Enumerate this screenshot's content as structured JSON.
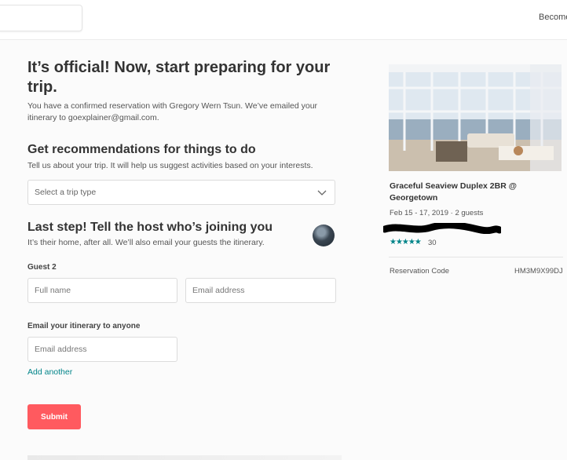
{
  "header": {
    "become_link": "Become"
  },
  "confirmation": {
    "title": "It’s official! Now, start preparing for your trip.",
    "message": "You have a confirmed reservation with Gregory Wern Tsun. We’ve emailed your itinerary to goexplainer@gmail.com."
  },
  "recommendations": {
    "title": "Get recommendations for things to do",
    "subtitle": "Tell us about your trip. It will help us suggest activities based on your interests.",
    "select_placeholder": "Select a trip type"
  },
  "guests": {
    "title": "Last step! Tell the host who’s joining you",
    "subtitle": "It’s their home, after all. We’ll also email your guests the itinerary.",
    "guest_label": "Guest 2",
    "full_name_placeholder": "Full name",
    "email_placeholder": "Email address"
  },
  "itinerary": {
    "label": "Email your itinerary to anyone",
    "email_placeholder": "Email address",
    "add_another": "Add another"
  },
  "submit_label": "Submit",
  "listing": {
    "title": "Graceful Seaview Duplex 2BR @ Georgetown",
    "dates_guests": "Feb 15 - 17, 2019 · 2 guests",
    "stars": "★★★★★",
    "rating": 4.5,
    "review_count": "30",
    "reservation_code_label": "Reservation Code",
    "reservation_code": "HM3M9X99DJ"
  },
  "colors": {
    "accent": "#ff5a5f",
    "link": "#008489",
    "stars": "#008489"
  },
  "icons": [
    "chevron-down-icon",
    "star-icon"
  ]
}
